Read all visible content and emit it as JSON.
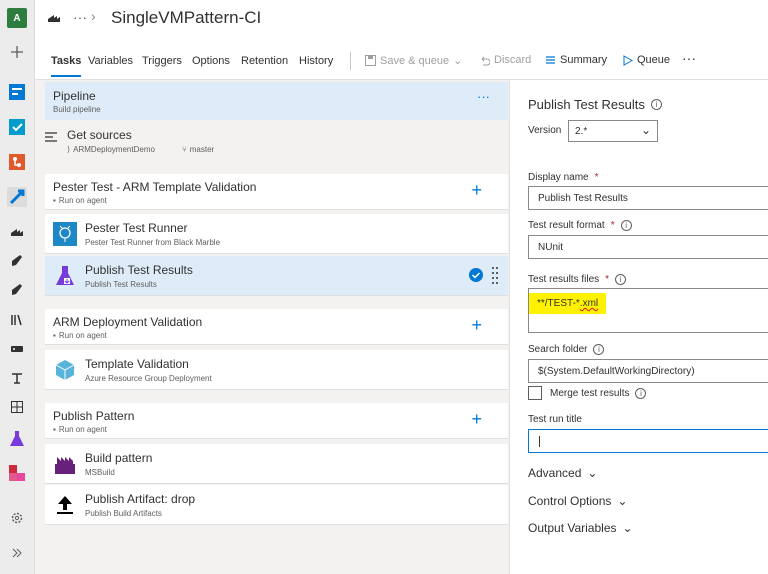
{
  "rail": {
    "avatar_initial": "A",
    "icons": [
      "plus-icon",
      "overview-icon",
      "boards-icon",
      "repos-icon",
      "pipelines-icon",
      "builds-icon",
      "releases-icon",
      "deployments-icon",
      "library-icon",
      "task-groups-icon",
      "deployment-groups-icon",
      "xaml-icon",
      "test-plans-icon",
      "artifacts-icon",
      "settings-icon",
      "expand-icon"
    ]
  },
  "header": {
    "ellipsis": "···",
    "title": "SingleVMPattern-CI"
  },
  "tabs": [
    "Tasks",
    "Variables",
    "Triggers",
    "Options",
    "Retention",
    "History"
  ],
  "toolbar": {
    "save_queue": "Save & queue",
    "discard": "Discard",
    "summary": "Summary",
    "queue": "Queue",
    "more": "···"
  },
  "pipeline": {
    "title": "Pipeline",
    "subtitle": "Build pipeline",
    "more": "···"
  },
  "get_sources": {
    "title": "Get sources",
    "repo": "ARMDeploymentDemo",
    "branch": "master"
  },
  "phases": [
    {
      "title": "Pester Test - ARM Template Validation",
      "subtitle": "Run on agent",
      "tasks": [
        {
          "title": "Pester Test Runner",
          "subtitle": "Pester Test Runner from Black Marble"
        },
        {
          "title": "Publish Test Results",
          "subtitle": "Publish Test Results"
        }
      ]
    },
    {
      "title": "ARM Deployment Validation",
      "subtitle": "Run on agent",
      "tasks": [
        {
          "title": "Template Validation",
          "subtitle": "Azure Resource Group Deployment"
        }
      ]
    },
    {
      "title": "Publish Pattern",
      "subtitle": "Run on agent",
      "tasks": [
        {
          "title": "Build pattern",
          "subtitle": "MSBuild"
        },
        {
          "title": "Publish Artifact: drop",
          "subtitle": "Publish Build Artifacts"
        }
      ]
    }
  ],
  "panel": {
    "title": "Publish Test Results",
    "version_label": "Version",
    "version_value": "2.*",
    "display_name_label": "Display name",
    "display_name_value": "Publish Test Results",
    "format_label": "Test result format",
    "format_value": "NUnit",
    "files_label": "Test results files",
    "files_value_prefix": "**/TEST-*",
    "files_value_suffix": ".xml",
    "search_folder_label": "Search folder",
    "search_folder_value": "$(System.DefaultWorkingDirectory)",
    "merge_label": "Merge test results",
    "run_title_label": "Test run title",
    "run_title_value": "",
    "sections": [
      "Advanced",
      "Control Options",
      "Output Variables"
    ]
  },
  "colors": {
    "accent": "#0078d4",
    "highlight": "#fff200",
    "selected": "#deecf9"
  }
}
